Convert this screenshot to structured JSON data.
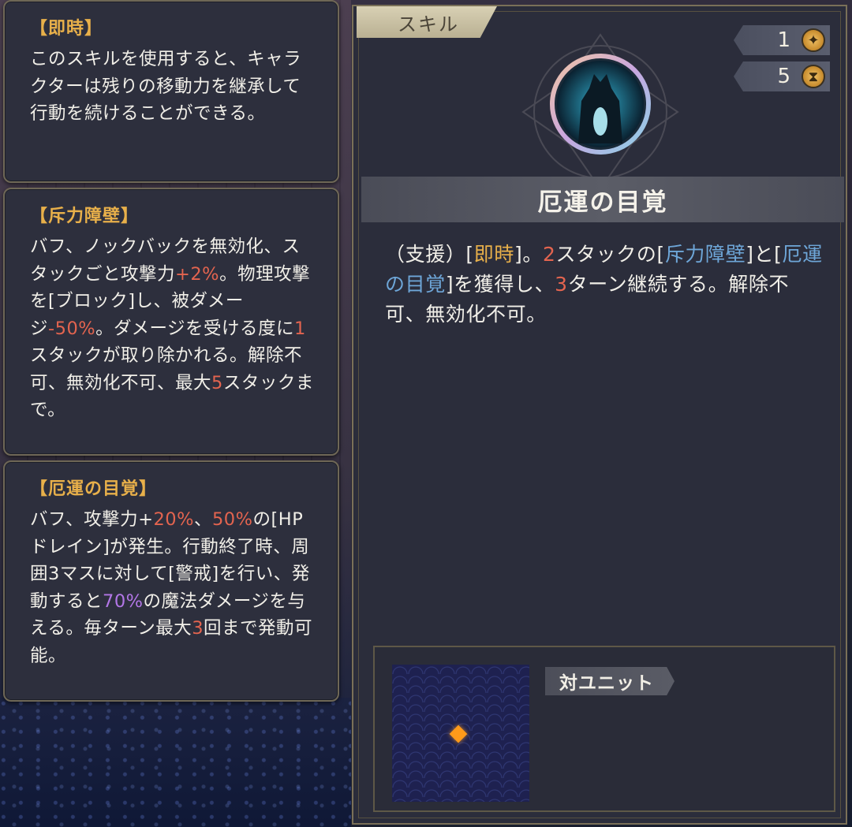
{
  "left_cards": [
    {
      "title": "【即時】",
      "body_segments": [
        {
          "text": "このスキルを使用すると、キャラクターは残りの移動力を継承して行動を続けることができる。",
          "color": "normal"
        }
      ]
    },
    {
      "title": "【斥力障壁】",
      "body_segments": [
        {
          "text": "バフ、ノックバックを無効化、スタックごと攻撃力",
          "color": "normal"
        },
        {
          "text": "+2%",
          "color": "red"
        },
        {
          "text": "。物理攻撃を[ブロック]し、被ダメージ",
          "color": "normal"
        },
        {
          "text": "-50%",
          "color": "red"
        },
        {
          "text": "。ダメージを受ける度に",
          "color": "normal"
        },
        {
          "text": "1",
          "color": "red"
        },
        {
          "text": "スタックが取り除かれる。解除不可、無効化不可、最大",
          "color": "normal"
        },
        {
          "text": "5",
          "color": "red"
        },
        {
          "text": "スタックまで。",
          "color": "normal"
        }
      ]
    },
    {
      "title": "【厄運の目覚】",
      "body_segments": [
        {
          "text": "バフ、攻撃力+",
          "color": "normal"
        },
        {
          "text": "20%",
          "color": "red"
        },
        {
          "text": "、",
          "color": "normal"
        },
        {
          "text": "50%",
          "color": "red"
        },
        {
          "text": "の[HPドレイン]が発生。行動終了時、周囲3マスに対して[警戒]を行い、発動すると",
          "color": "normal"
        },
        {
          "text": "70%",
          "color": "purple"
        },
        {
          "text": "の魔法ダメージを与える。毎ターン最大",
          "color": "normal"
        },
        {
          "text": "3",
          "color": "red"
        },
        {
          "text": "回まで発動可能。",
          "color": "normal"
        }
      ]
    }
  ],
  "panel": {
    "tab_label": "スキル",
    "cost": {
      "value": "1",
      "icon": "star-cost-icon"
    },
    "cooldown": {
      "value": "5",
      "icon": "hourglass-icon"
    },
    "skill_name": "厄運の目覚",
    "description_segments": [
      {
        "text": "（支援）[",
        "color": "normal"
      },
      {
        "text": "即時",
        "color": "gold"
      },
      {
        "text": "]。",
        "color": "normal"
      },
      {
        "text": "2",
        "color": "red"
      },
      {
        "text": "スタックの[",
        "color": "normal"
      },
      {
        "text": "斥力障壁",
        "color": "blue"
      },
      {
        "text": "]と[",
        "color": "normal"
      },
      {
        "text": "厄運の目覚",
        "color": "blue"
      },
      {
        "text": "]を獲得し、",
        "color": "normal"
      },
      {
        "text": "3",
        "color": "red"
      },
      {
        "text": "ターン継続する。解除不可、無効化不可。",
        "color": "normal"
      }
    ],
    "target_label": "対ユニット"
  },
  "colors": {
    "red": "#e3644f",
    "purple": "#b276e6",
    "blue": "#6ea6d8",
    "gold": "#e8b04a"
  }
}
